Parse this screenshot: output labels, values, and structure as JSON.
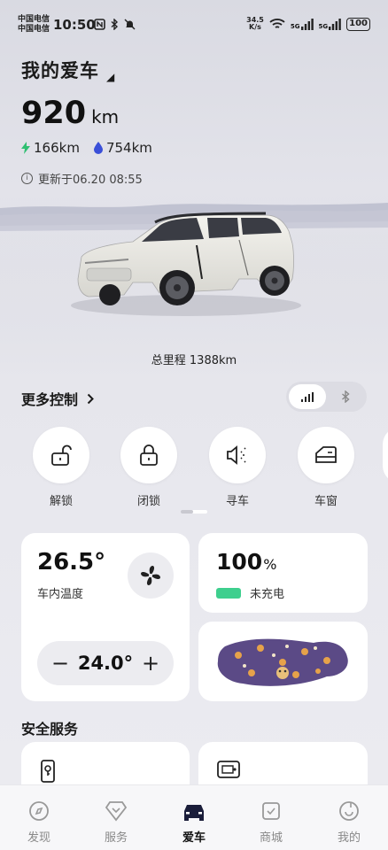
{
  "status_bar": {
    "carrier_1": "中国电信",
    "carrier_2": "中国电信",
    "time": "10:50",
    "net_speed_value": "34.5",
    "net_speed_unit": "K/s",
    "signal_1": "5G",
    "signal_2": "5G",
    "battery": "100"
  },
  "header": {
    "title": "我的爱车",
    "range_value": "920",
    "range_unit": "km",
    "electric_range": "166km",
    "fuel_range": "754km",
    "updated": "更新于06.20 08:55"
  },
  "car": {
    "odometer": "总里程 1388km"
  },
  "controls": {
    "more_label": "更多控制",
    "connection_mode": "cellular",
    "items": [
      {
        "label": "解锁",
        "icon": "unlock-icon"
      },
      {
        "label": "闭锁",
        "icon": "lock-icon"
      },
      {
        "label": "寻车",
        "icon": "find-car-icon"
      },
      {
        "label": "车窗",
        "icon": "window-icon"
      }
    ],
    "page_indicator": {
      "current": 1,
      "total": 2
    }
  },
  "climate": {
    "interior_temp": "26.5°",
    "interior_label": "车内温度",
    "setpoint": "24.0°",
    "minus": "−",
    "plus": "+"
  },
  "battery_card": {
    "level": "100",
    "unit": "%",
    "status": "未充电",
    "fill_fraction": 1.0
  },
  "safety": {
    "title": "安全服务"
  },
  "tabbar": {
    "tabs": [
      {
        "label": "发现",
        "icon": "discover-icon",
        "active": false
      },
      {
        "label": "服务",
        "icon": "service-icon",
        "active": false
      },
      {
        "label": "爱车",
        "icon": "car-icon",
        "active": true
      },
      {
        "label": "商城",
        "icon": "shop-icon",
        "active": false
      },
      {
        "label": "我的",
        "icon": "profile-icon",
        "active": false
      }
    ]
  },
  "colors": {
    "accent_green": "#3ecf8e",
    "electric_green": "#2fbf71",
    "fuel_blue": "#3a4fd8"
  }
}
